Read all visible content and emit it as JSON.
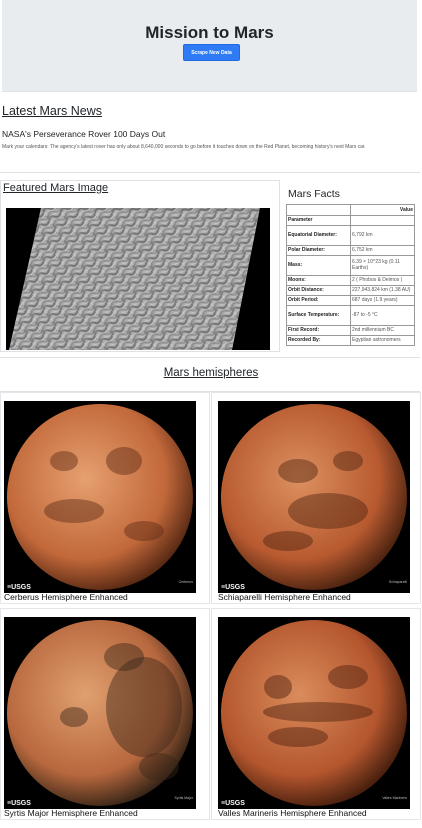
{
  "header": {
    "title": "Mission to Mars",
    "scrape_button": "Scrape New Data"
  },
  "news": {
    "heading": "Latest Mars News",
    "title": "NASA's Perseverance Rover 100 Days Out",
    "teaser": "Mark your calendars: The agency's latest rover has only about 8,640,000 seconds to go before it touches down on the Red Planet, becoming history's next Mars car."
  },
  "featured": {
    "heading": "Featured Mars Image"
  },
  "facts": {
    "heading": "Mars Facts",
    "column_header": "Value",
    "index_header": "Parameter",
    "rows": [
      {
        "label": "Equatorial Diameter:",
        "value": "6,792 km"
      },
      {
        "label": "Polar Diameter:",
        "value": "6,752 km"
      },
      {
        "label": "Mass:",
        "value": "6.39 × 10^23 kg (0.11 Earths)"
      },
      {
        "label": "Moons:",
        "value": "2 ( Phobos & Deimos )"
      },
      {
        "label": "Orbit Distance:",
        "value": "227,943,824 km (1.38 AU)"
      },
      {
        "label": "Orbit Period:",
        "value": "687 days (1.9 years)"
      },
      {
        "label": "Surface Temperature:",
        "value": "-87 to -5 °C"
      },
      {
        "label": "First Record:",
        "value": "2nd millennium BC"
      },
      {
        "label": "Recorded By:",
        "value": "Egyptian astronomers"
      }
    ]
  },
  "hemispheres": {
    "heading": "Mars hemispheres",
    "logo_text": "≡USGS",
    "items": [
      {
        "title": "Cerberus Hemisphere Enhanced",
        "caption": "Cerberus",
        "base": "#c2683a",
        "light": "#e6a070",
        "dark": "#5a2a14"
      },
      {
        "title": "Schiaparelli Hemisphere Enhanced",
        "caption": "Schiaparelli",
        "base": "#b85a30",
        "light": "#dc9060",
        "dark": "#4e2410"
      },
      {
        "title": "Syrtis Major Hemisphere Enhanced",
        "caption": "Syrtis Major",
        "base": "#b8683e",
        "light": "#e0a070",
        "dark": "#3a2618"
      },
      {
        "title": "Valles Marineris Hemisphere Enhanced",
        "caption": "Valles Marineris",
        "base": "#b4562e",
        "light": "#da8c5c",
        "dark": "#4a200e"
      }
    ]
  }
}
